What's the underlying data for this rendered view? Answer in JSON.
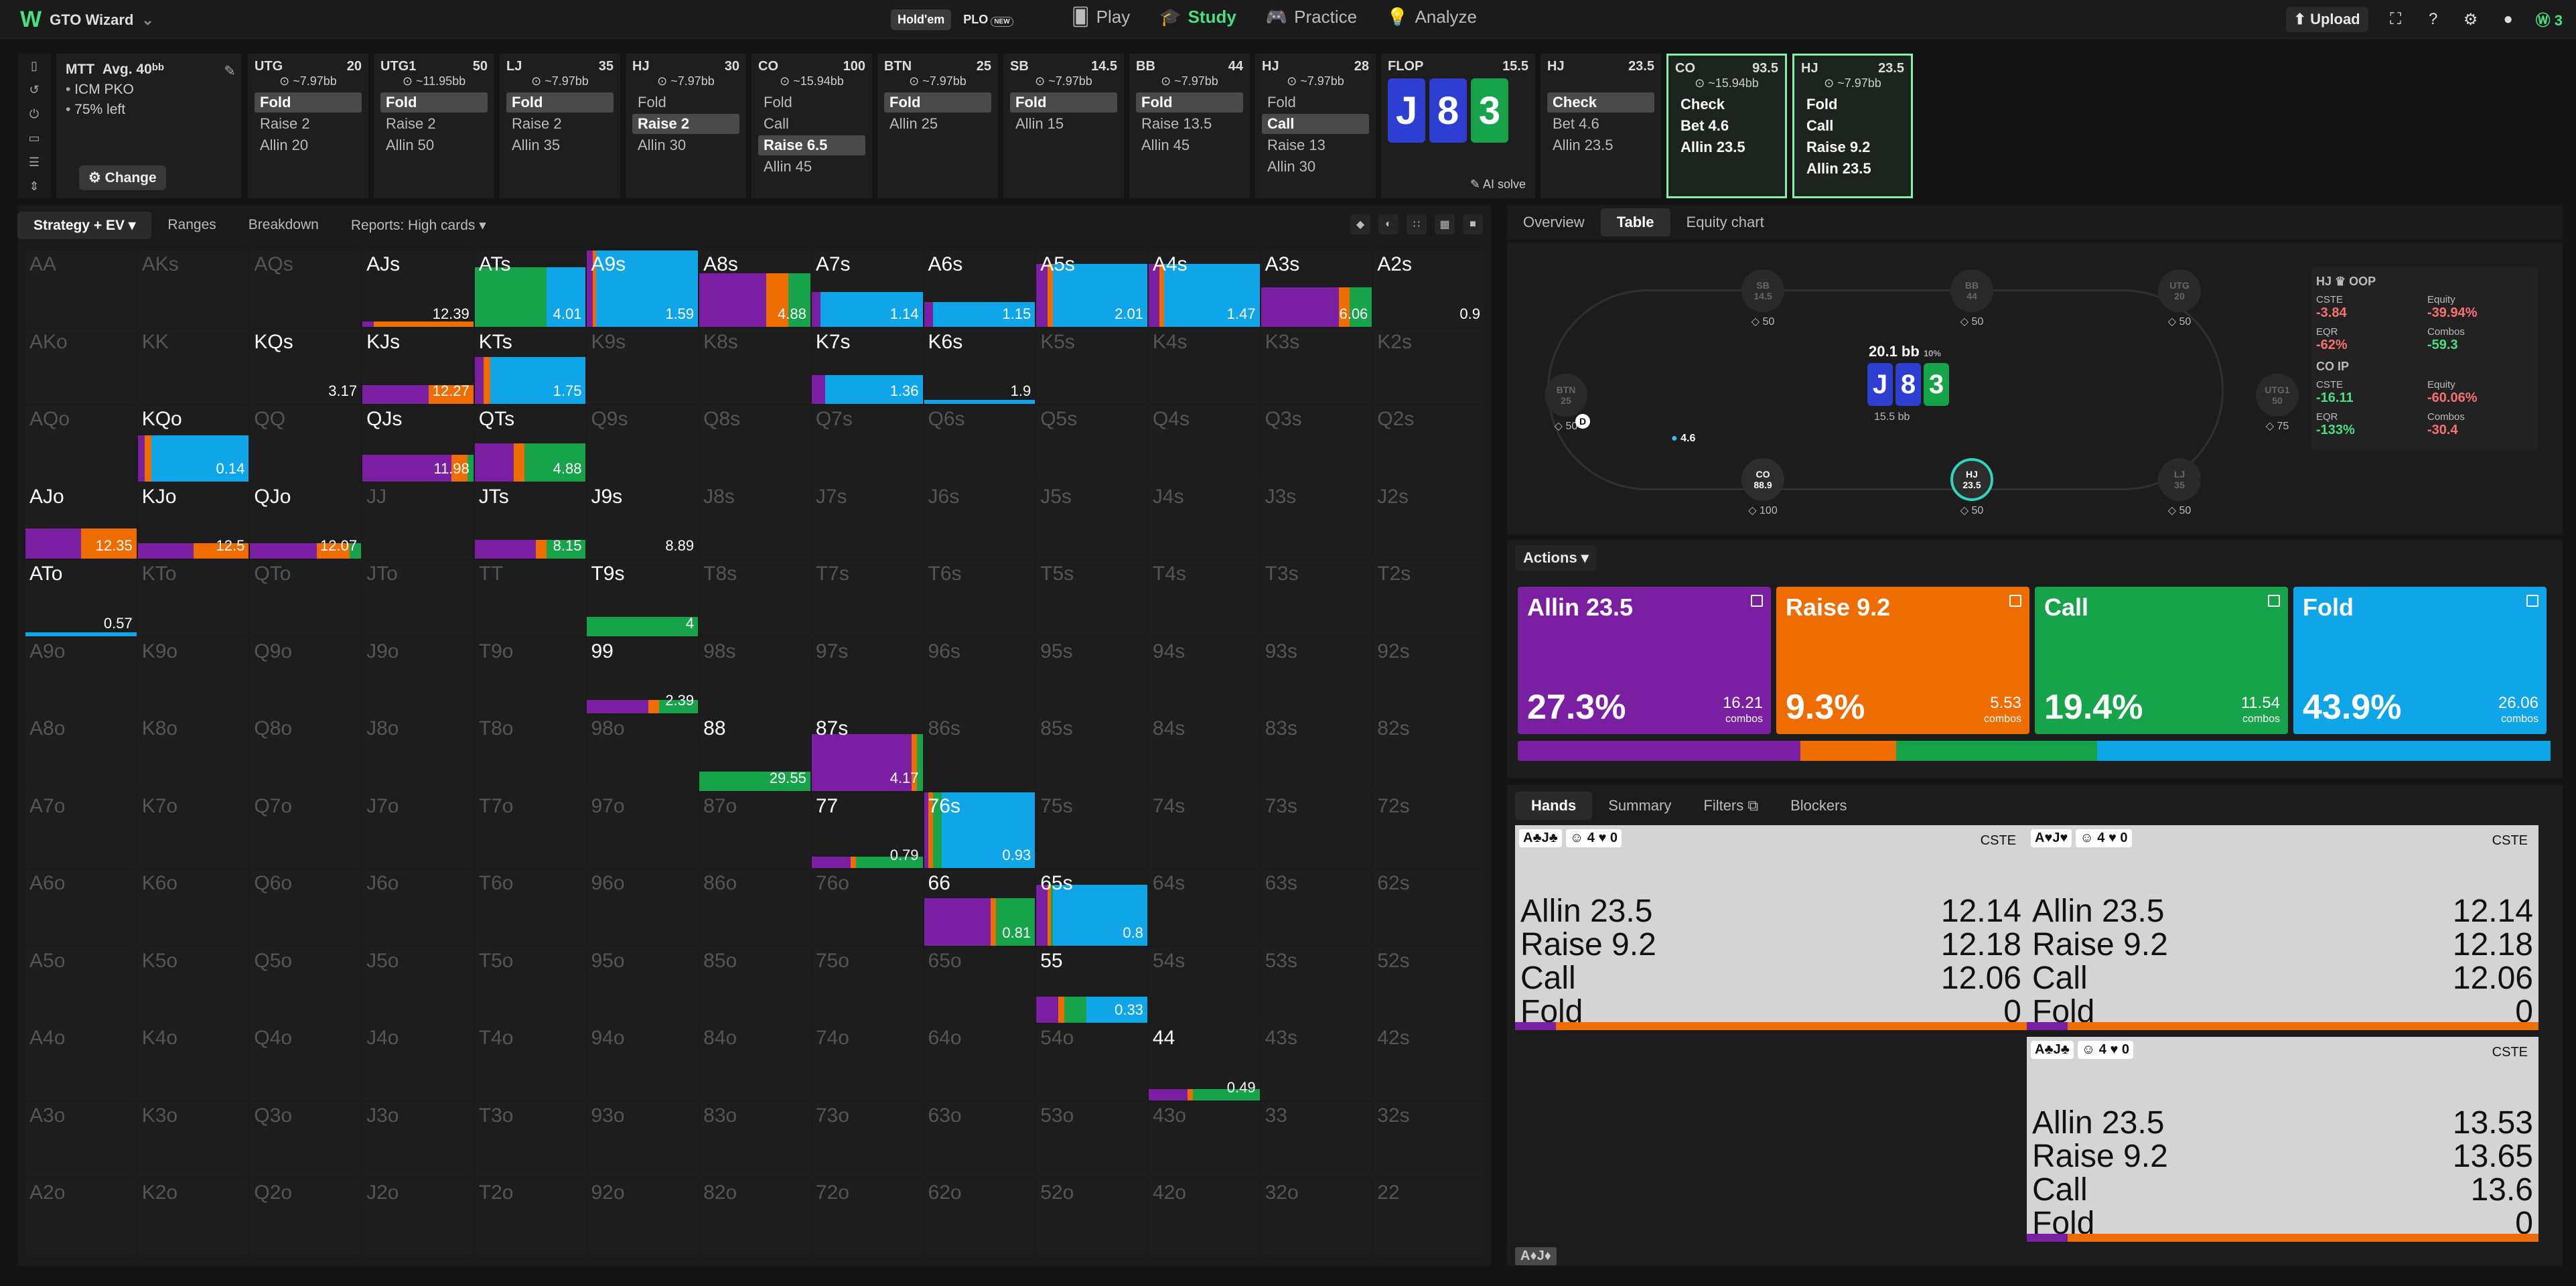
{
  "colors": {
    "allin": "#7b1fa2",
    "raise": "#ef6c00",
    "call": "#16a34a",
    "fold": "#0ea5e9",
    "accent": "#4ade80"
  },
  "topbar": {
    "logo": "GTO Wizard",
    "mode_holdem": "Hold'em",
    "mode_plo": "PLO",
    "new_badge": "NEW",
    "nav": [
      "Play",
      "Study",
      "Practice",
      "Analyze"
    ],
    "upload": "Upload",
    "coin": "3"
  },
  "mtt": {
    "title": "MTT",
    "avg": "Avg. 40",
    "avg_unit": "bb",
    "lines": [
      "ICM PKO",
      "75% left"
    ],
    "change": "Change"
  },
  "sequence": [
    {
      "pos": "UTG",
      "stack": "20",
      "bb": "~7.97bb",
      "actions": [
        "Fold",
        "Raise 2",
        "Allin 20"
      ],
      "sel": 0
    },
    {
      "pos": "UTG1",
      "stack": "50",
      "bb": "~11.95bb",
      "actions": [
        "Fold",
        "Raise 2",
        "Allin 50"
      ],
      "sel": 0
    },
    {
      "pos": "LJ",
      "stack": "35",
      "bb": "~7.97bb",
      "actions": [
        "Fold",
        "Raise 2",
        "Allin 35"
      ],
      "sel": 0
    },
    {
      "pos": "HJ",
      "stack": "30",
      "bb": "~7.97bb",
      "actions": [
        "Fold",
        "Raise 2",
        "Allin 30"
      ],
      "sel": 1
    },
    {
      "pos": "CO",
      "stack": "100",
      "bb": "~15.94bb",
      "actions": [
        "Fold",
        "Call",
        "Raise 6.5",
        "Allin 45"
      ],
      "sel": 2
    },
    {
      "pos": "BTN",
      "stack": "25",
      "bb": "~7.97bb",
      "actions": [
        "Fold",
        "Allin 25"
      ],
      "sel": 0
    },
    {
      "pos": "SB",
      "stack": "14.5",
      "bb": "~7.97bb",
      "actions": [
        "Fold",
        "Allin 15"
      ],
      "sel": 0
    },
    {
      "pos": "BB",
      "stack": "44",
      "bb": "~7.97bb",
      "actions": [
        "Fold",
        "Raise 13.5",
        "Allin 45"
      ],
      "sel": 0
    },
    {
      "pos": "HJ",
      "stack": "28",
      "bb": "~7.97bb",
      "actions": [
        "Fold",
        "Call",
        "Raise 13",
        "Allin 30"
      ],
      "sel": 1
    }
  ],
  "flop": {
    "label": "FLOP",
    "pot": "15.5",
    "cards": [
      "J",
      "8",
      "3"
    ],
    "ai": "AI solve"
  },
  "seq_after": [
    {
      "pos": "HJ",
      "stack": "23.5",
      "bb": "",
      "actions": [
        "Check",
        "Bet 4.6",
        "Allin 23.5"
      ],
      "sel": 0
    },
    {
      "pos": "CO",
      "stack": "93.5",
      "bb": "~15.94bb",
      "actions": [
        "Check",
        "Bet 4.6",
        "Allin 23.5"
      ],
      "sel": -1
    },
    {
      "pos": "HJ",
      "stack": "23.5",
      "bb": "~7.97bb",
      "actions": [
        "Fold",
        "Call",
        "Raise 9.2",
        "Allin 23.5"
      ],
      "sel": -1
    }
  ],
  "left_tabs": [
    "Strategy + EV",
    "Ranges",
    "Breakdown",
    "Reports: High cards"
  ],
  "grid": [
    [
      "AA",
      "AKs",
      "AQs",
      "AJs",
      "ATs",
      "A9s",
      "A8s",
      "A7s",
      "A6s",
      "A5s",
      "A4s",
      "A3s",
      "A2s"
    ],
    [
      "AKo",
      "KK",
      "KQs",
      "KJs",
      "KTs",
      "K9s",
      "K8s",
      "K7s",
      "K6s",
      "K5s",
      "K4s",
      "K3s",
      "K2s"
    ],
    [
      "AQo",
      "KQo",
      "QQ",
      "QJs",
      "QTs",
      "Q9s",
      "Q8s",
      "Q7s",
      "Q6s",
      "Q5s",
      "Q4s",
      "Q3s",
      "Q2s"
    ],
    [
      "AJo",
      "KJo",
      "QJo",
      "JJ",
      "JTs",
      "J9s",
      "J8s",
      "J7s",
      "J6s",
      "J5s",
      "J4s",
      "J3s",
      "J2s"
    ],
    [
      "ATo",
      "KTo",
      "QTo",
      "JTo",
      "TT",
      "T9s",
      "T8s",
      "T7s",
      "T6s",
      "T5s",
      "T4s",
      "T3s",
      "T2s"
    ],
    [
      "A9o",
      "K9o",
      "Q9o",
      "J9o",
      "T9o",
      "99",
      "98s",
      "97s",
      "96s",
      "95s",
      "94s",
      "93s",
      "92s"
    ],
    [
      "A8o",
      "K8o",
      "Q8o",
      "J8o",
      "T8o",
      "98o",
      "88",
      "87s",
      "86s",
      "85s",
      "84s",
      "83s",
      "82s"
    ],
    [
      "A7o",
      "K7o",
      "Q7o",
      "J7o",
      "T7o",
      "97o",
      "87o",
      "77",
      "76s",
      "75s",
      "74s",
      "73s",
      "72s"
    ],
    [
      "A6o",
      "K6o",
      "Q6o",
      "J6o",
      "T6o",
      "96o",
      "86o",
      "76o",
      "66",
      "65s",
      "64s",
      "63s",
      "62s"
    ],
    [
      "A5o",
      "K5o",
      "Q5o",
      "J5o",
      "T5o",
      "95o",
      "85o",
      "75o",
      "65o",
      "55",
      "54s",
      "53s",
      "52s"
    ],
    [
      "A4o",
      "K4o",
      "Q4o",
      "J4o",
      "T4o",
      "94o",
      "84o",
      "74o",
      "64o",
      "54o",
      "44",
      "43s",
      "42s"
    ],
    [
      "A3o",
      "K3o",
      "Q3o",
      "J3o",
      "T3o",
      "93o",
      "83o",
      "73o",
      "63o",
      "53o",
      "43o",
      "33",
      "32s"
    ],
    [
      "A2o",
      "K2o",
      "Q2o",
      "J2o",
      "T2o",
      "92o",
      "82o",
      "72o",
      "62o",
      "52o",
      "42o",
      "32o",
      "22"
    ]
  ],
  "cells": {
    "AJs": {
      "v": "12.39",
      "h": 0.07,
      "m": [
        0.1,
        0.9,
        0,
        0
      ]
    },
    "ATs": {
      "v": "4.01",
      "h": 0.78,
      "m": [
        0,
        0,
        0.65,
        0.35
      ]
    },
    "A9s": {
      "v": "1.59",
      "h": 1.0,
      "m": [
        0.05,
        0.03,
        0,
        0.92
      ]
    },
    "A8s": {
      "v": "4.88",
      "h": 0.7,
      "m": [
        0.6,
        0.2,
        0.2,
        0
      ]
    },
    "A7s": {
      "v": "1.14",
      "h": 0.45,
      "m": [
        0.08,
        0,
        0,
        0.92
      ]
    },
    "A6s": {
      "v": "1.15",
      "h": 0.32,
      "m": [
        0.08,
        0,
        0,
        0.92
      ]
    },
    "A5s": {
      "v": "2.01",
      "h": 0.82,
      "m": [
        0.1,
        0.05,
        0,
        0.85
      ]
    },
    "A4s": {
      "v": "1.47",
      "h": 0.82,
      "m": [
        0.1,
        0.04,
        0,
        0.86
      ]
    },
    "A3s": {
      "v": "6.06",
      "h": 0.52,
      "m": [
        0.7,
        0.1,
        0.2,
        0
      ]
    },
    "A2s": {
      "v": "0.9",
      "h": 0,
      "m": [
        0,
        0,
        0,
        0
      ]
    },
    "KQs": {
      "v": "3.17",
      "h": 0,
      "m": [
        0,
        0,
        0,
        0
      ]
    },
    "KJs": {
      "v": "12.27",
      "h": 0.25,
      "m": [
        0.6,
        0.4,
        0,
        0
      ]
    },
    "KTs": {
      "v": "1.75",
      "h": 0.62,
      "m": [
        0.08,
        0.06,
        0,
        0.86
      ]
    },
    "K7s": {
      "v": "1.36",
      "h": 0.38,
      "m": [
        0.12,
        0,
        0,
        0.88
      ]
    },
    "K6s": {
      "v": "1.9",
      "h": 0.05,
      "m": [
        0,
        0,
        0,
        1
      ]
    },
    "KQo": {
      "v": "0.14",
      "h": 0.6,
      "m": [
        0.06,
        0.06,
        0,
        0.88
      ]
    },
    "QJs": {
      "v": "11.98",
      "h": 0.35,
      "m": [
        0.8,
        0.15,
        0.05,
        0
      ]
    },
    "QTs": {
      "v": "4.88",
      "h": 0.5,
      "m": [
        0.35,
        0.1,
        0.55,
        0
      ]
    },
    "AJo": {
      "v": "12.35",
      "h": 0.4,
      "m": [
        0.5,
        0.5,
        0,
        0
      ]
    },
    "KJo": {
      "v": "12.5",
      "h": 0.2,
      "m": [
        0.5,
        0.5,
        0,
        0
      ]
    },
    "QJo": {
      "v": "12.07",
      "h": 0.2,
      "m": [
        0.6,
        0.3,
        0.1,
        0
      ]
    },
    "JTs": {
      "v": "8.15",
      "h": 0.25,
      "m": [
        0.55,
        0.1,
        0.35,
        0
      ]
    },
    "J9s": {
      "v": "8.89",
      "h": 0,
      "m": [
        0,
        0,
        0,
        0
      ]
    },
    "ATo": {
      "v": "0.57",
      "h": 0.05,
      "m": [
        0,
        0,
        0,
        1
      ]
    },
    "T9s": {
      "v": "4",
      "h": 0.25,
      "m": [
        0,
        0,
        1,
        0
      ]
    },
    "99": {
      "v": "2.39",
      "h": 0.18,
      "m": [
        0.55,
        0.1,
        0.35,
        0
      ]
    },
    "88": {
      "v": "29.55",
      "h": 0.25,
      "m": [
        0,
        0,
        1,
        0
      ]
    },
    "87s": {
      "v": "4.17",
      "h": 0.75,
      "m": [
        0.9,
        0.05,
        0.05,
        0
      ]
    },
    "77": {
      "v": "0.79",
      "h": 0.15,
      "m": [
        0.35,
        0.05,
        0.6,
        0
      ]
    },
    "76s": {
      "v": "0.93",
      "h": 1.0,
      "m": [
        0.04,
        0.04,
        0.08,
        0.84
      ]
    },
    "66": {
      "v": "0.81",
      "h": 0.62,
      "m": [
        0.6,
        0.05,
        0.35,
        0
      ]
    },
    "65s": {
      "v": "0.8",
      "h": 0.8,
      "m": [
        0.1,
        0.03,
        0.02,
        0.85
      ]
    },
    "55": {
      "v": "0.33",
      "h": 0.35,
      "m": [
        0.2,
        0.05,
        0.2,
        0.55
      ]
    },
    "44": {
      "v": "0.49",
      "h": 0.15,
      "m": [
        0.35,
        0.05,
        0.6,
        0
      ]
    }
  },
  "right_tabs": [
    "Overview",
    "Table",
    "Equity chart"
  ],
  "table": {
    "seats": [
      {
        "name": "SB",
        "stack": "14.5",
        "chips": "50"
      },
      {
        "name": "BB",
        "stack": "44",
        "chips": "50"
      },
      {
        "name": "UTG",
        "stack": "20",
        "chips": "50"
      },
      {
        "name": "BTN",
        "stack": "25",
        "chips": "50"
      },
      {
        "name": "UTG1",
        "stack": "50",
        "chips": "75"
      },
      {
        "name": "CO",
        "stack": "88.9",
        "chips": "100"
      },
      {
        "name": "HJ",
        "stack": "23.5",
        "chips": "50"
      },
      {
        "name": "LJ",
        "stack": "35",
        "chips": "50"
      }
    ],
    "pot": "20.1 bb",
    "pot_pct": "10%",
    "pot_small": "15.5 bb",
    "bet": "4.6",
    "dealer": "D",
    "hj_title": "HJ ♛ OOP",
    "hj": {
      "cste": "-3.84",
      "equity": "-39.94%",
      "eqr": "-62%",
      "combos": "-59.3"
    },
    "co_title": "CO IP",
    "co": {
      "cste": "-16.11",
      "equity": "-60.06%",
      "eqr": "-133%",
      "combos": "-30.4"
    },
    "labels": {
      "cste": "CSTE",
      "equity": "Equity",
      "eqr": "EQR",
      "combos": "Combos"
    }
  },
  "actions": {
    "title": "Actions",
    "items": [
      {
        "name": "Allin 23.5",
        "pct": "27.3%",
        "combos": "16.21",
        "frac": 0.273
      },
      {
        "name": "Raise 9.2",
        "pct": "9.3%",
        "combos": "5.53",
        "frac": 0.093
      },
      {
        "name": "Call",
        "pct": "19.4%",
        "combos": "11.54",
        "frac": 0.194
      },
      {
        "name": "Fold",
        "pct": "43.9%",
        "combos": "26.06",
        "frac": 0.439
      }
    ],
    "combos_label": "combos"
  },
  "hand_tabs": [
    "Hands",
    "Summary",
    "Filters",
    "Blockers"
  ],
  "hands": [
    {
      "cards": "A♣J♣",
      "c1": "4",
      "c2": "0",
      "rows": [
        [
          "Allin 23.5",
          "12.14"
        ],
        [
          "Raise 9.2",
          "12.18"
        ],
        [
          "Call",
          "12.06"
        ],
        [
          "Fold",
          "0"
        ]
      ]
    },
    {
      "cards": "A♥J♥",
      "c1": "4",
      "c2": "0",
      "rows": [
        [
          "Allin 23.5",
          "12.14"
        ],
        [
          "Raise 9.2",
          "12.18"
        ],
        [
          "Call",
          "12.06"
        ],
        [
          "Fold",
          "0"
        ]
      ]
    },
    {
      "cards": "A♣J♣",
      "c1": "4",
      "c2": "0",
      "rows": [
        [
          "Allin 23.5",
          "13.53"
        ],
        [
          "Raise 9.2",
          "13.65"
        ],
        [
          "Call",
          "13.6"
        ],
        [
          "Fold",
          "0"
        ]
      ]
    }
  ],
  "hand_tag": "A♦J♦",
  "cste": "CSTE"
}
